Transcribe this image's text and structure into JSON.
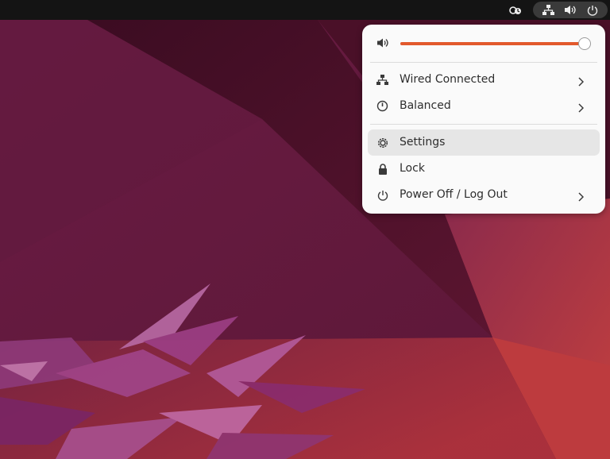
{
  "topbar": {
    "tray_left_icon": "accessibility-icon",
    "tray_icons": [
      "network-wired-icon",
      "volume-icon",
      "power-icon"
    ]
  },
  "quick_menu": {
    "volume": {
      "icon": "volume-icon",
      "level": 0.97,
      "accent": "#e2592c"
    },
    "items": [
      {
        "label": "Wired Connected",
        "icon": "network-wired-icon",
        "has_submenu": true
      },
      {
        "label": "Balanced",
        "icon": "power-profile-icon",
        "has_submenu": true
      },
      {
        "label": "Settings",
        "icon": "gear-icon",
        "has_submenu": false,
        "highlighted": true
      },
      {
        "label": "Lock",
        "icon": "lock-icon",
        "has_submenu": false
      },
      {
        "label": "Power Off / Log Out",
        "icon": "power-icon",
        "has_submenu": true
      }
    ]
  },
  "colors": {
    "wallpaper_base": "#5a1836",
    "panel_bg": "#fafafa",
    "topbar_bg": "#141414"
  }
}
